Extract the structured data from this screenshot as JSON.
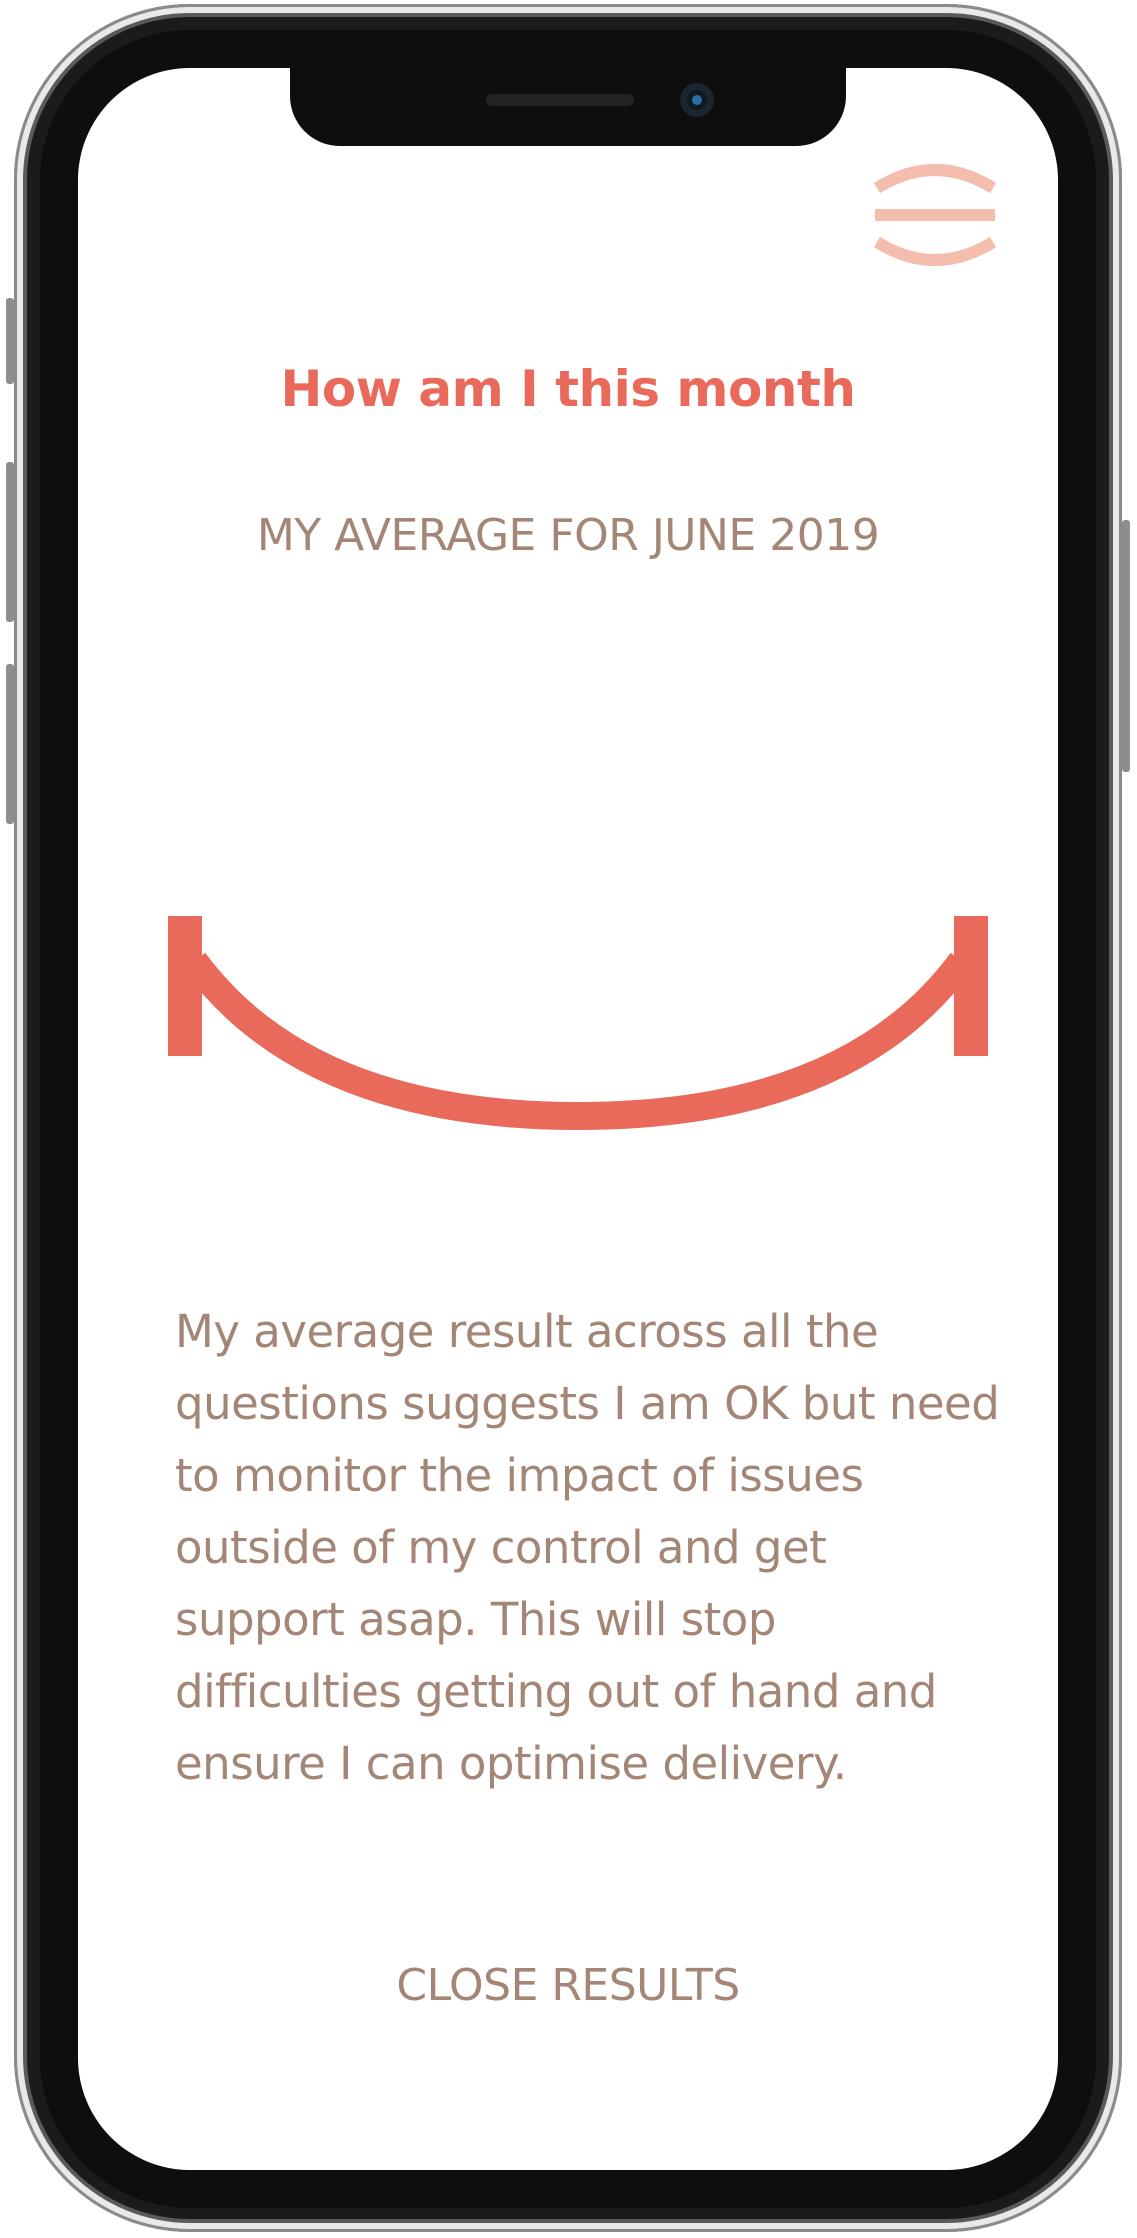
{
  "colors": {
    "accent": "#E9695A",
    "accent_light": "#F4BDAE",
    "text": "#A48676"
  },
  "header": {
    "menu_icon": "menu-icon"
  },
  "main": {
    "title": "How am I this month",
    "subtitle": "MY AVERAGE FOR JUNE 2019",
    "mood_icon": "smile-gauge-icon",
    "description": "My average result across all the questions suggests I am OK but need to monitor the impact of issues outside of my control and get support asap. This will stop difficulties getting out of hand and ensure I can optimise delivery."
  },
  "footer": {
    "close_label": "CLOSE RESULTS"
  }
}
